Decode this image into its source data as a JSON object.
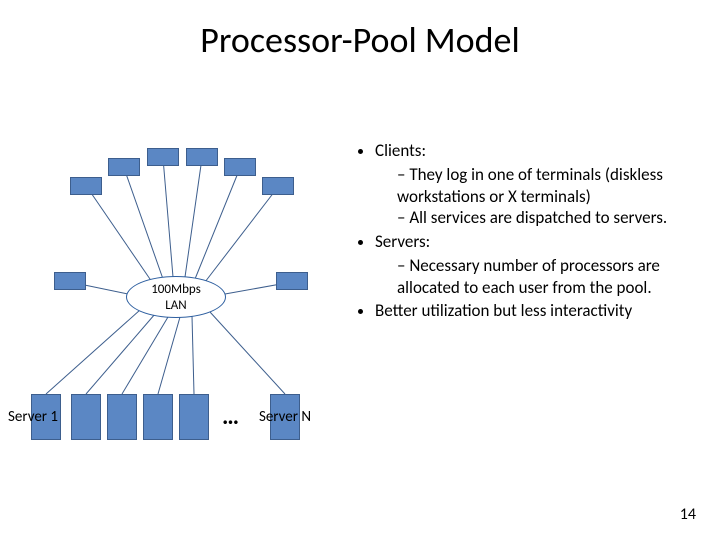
{
  "title": "Processor-Pool Model",
  "bullets": {
    "clients": {
      "label": "Clients:",
      "sub1": "They log in one of terminals (diskless workstations or X terminals)",
      "sub2": "All services are dispatched to servers."
    },
    "servers": {
      "label": "Servers:",
      "sub1": "Necessary number of processors are allocated to each user from the pool."
    },
    "util": "Better utilization but less interactivity"
  },
  "diagram": {
    "hub_line1": "100Mbps",
    "hub_line2": "LAN",
    "server1": "Server 1",
    "serverN": "Server N",
    "ellipsis": "…"
  },
  "page_number": "14"
}
